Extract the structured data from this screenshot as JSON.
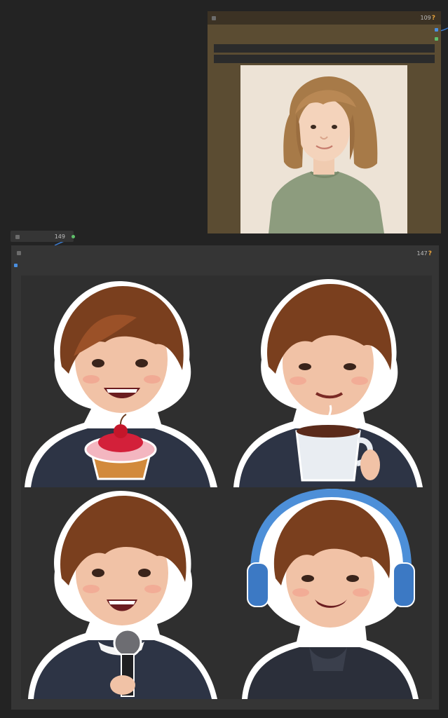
{
  "canvas": {
    "background": "#232323",
    "wire_color": "#3b7bd0"
  },
  "nodes": {
    "load_image": {
      "id": "109",
      "help": "?",
      "color": "#5b4c32"
    },
    "collapsed": {
      "id": "149"
    },
    "preview": {
      "id": "147",
      "help": "?"
    }
  },
  "images": {
    "source_photo": {
      "subject": "child-portrait"
    },
    "stickers": [
      {
        "prop": "cupcake-icon"
      },
      {
        "prop": "coffee-mug-icon"
      },
      {
        "prop": "microphone-icon"
      },
      {
        "prop": "headphones-icon"
      }
    ]
  }
}
